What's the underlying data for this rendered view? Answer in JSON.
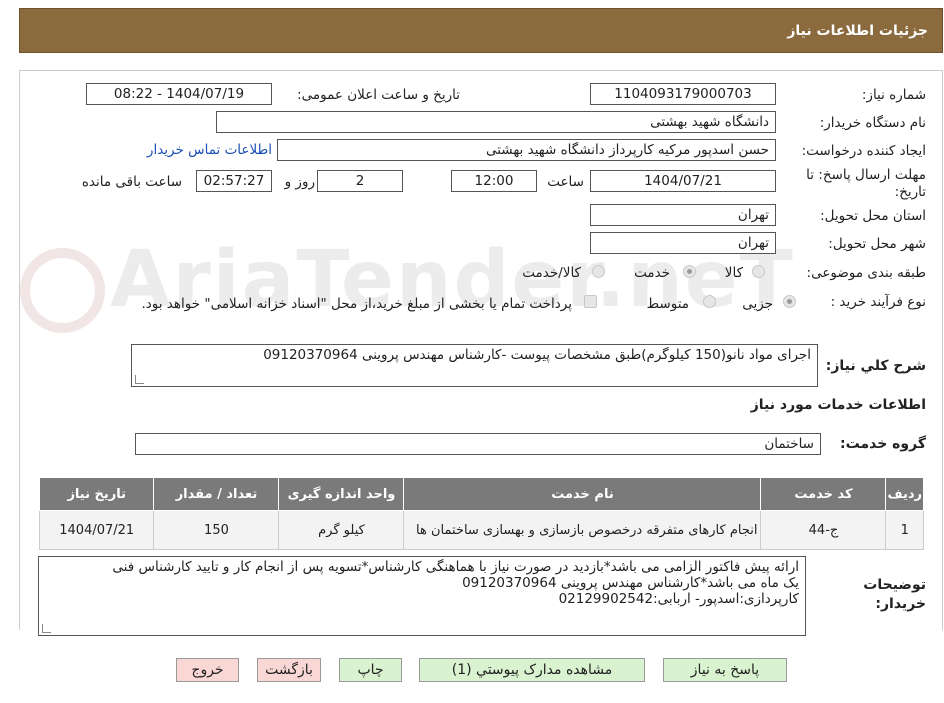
{
  "header": {
    "title": "جزئیات اطلاعات نیاز"
  },
  "form": {
    "need_number_label": "شماره نیاز:",
    "need_number": "1104093179000703",
    "announce_label": "تاریخ و ساعت اعلان عمومی:",
    "announce_value": "1404/07/19 - 08:22",
    "buyer_label": "نام دستگاه خریدار:",
    "buyer_value": "دانشگاه شهید بهشتی",
    "requester_label": "ایجاد کننده درخواست:",
    "requester_value": "حسن اسدپور مرکیه کارپرداز دانشگاه شهید بهشتی",
    "contact_link": "اطلاعات تماس خریدار",
    "deadline_label_1": "مهلت ارسال پاسخ: تا",
    "deadline_label_2": "تاریخ:",
    "deadline_date": "1404/07/21",
    "time_label": "ساعت",
    "deadline_time": "12:00",
    "days_value": "2",
    "days_label": "روز و",
    "remaining_value": "02:57:27",
    "remaining_label": "ساعت باقی مانده",
    "province_label": "استان محل تحویل:",
    "province_value": "تهران",
    "city_label": "شهر محل تحویل:",
    "city_value": "تهران",
    "category_label": "طبقه بندی موضوعی:",
    "category_options": [
      "کالا",
      "خدمت",
      "کالا/خدمت"
    ],
    "category_selected": "خدمت",
    "process_label": "نوع فرآیند خرید :",
    "process_options": [
      "جزیی",
      "متوسط"
    ],
    "process_selected": "جزیی",
    "payment_note": "پرداخت تمام یا بخشی از مبلغ خرید،از محل \"اسناد خزانه اسلامی\" خواهد بود.",
    "description_label": "شرح کلي نیاز:",
    "description_value": "اجرای مواد نانو(150 کیلوگرم)طبق مشخصات پیوست -کارشناس مهندس پروینی 09120370964",
    "services_heading": "اطلاعات خدمات مورد نیاز",
    "service_group_label": "گروه خدمت:",
    "service_group_value": "ساختمان"
  },
  "table": {
    "headers": [
      "ردیف",
      "کد خدمت",
      "نام خدمت",
      "واحد اندازه گیری",
      "تعداد / مقدار",
      "تاریخ نیاز"
    ],
    "rows": [
      [
        "1",
        "ج-44",
        "انجام کارهای متفرقه درخصوص بازسازی و بهسازی ساختمان ها",
        "کیلو گرم",
        "150",
        "1404/07/21"
      ]
    ]
  },
  "buyer_notes": {
    "label_1": "توضیحات",
    "label_2": "خریدار:",
    "line1": "ارائه پیش فاکتور الزامی می باشد*بازدید در صورت نیاز با هماهنگی کارشناس*تسویه پس از انجام کار و تایید کارشناس فنی",
    "line2": "یک ماه می باشد*کارشناس مهندس پروینی 09120370964",
    "line3": "کارپردازی:اسدپور- اربابی:02129902542"
  },
  "buttons": {
    "reply": "پاسخ به نیاز",
    "attachments": "مشاهده مدارک پیوستي (1)",
    "print": "چاپ",
    "back": "بازگشت",
    "exit": "خروج"
  },
  "watermark": "AriaTender.neT",
  "colors": {
    "header_bg": "#8b6a3e",
    "table_header": "#7a7a7a",
    "button_green": "#d9f2d0",
    "button_pink": "#f9d7d5",
    "link": "#1a4fb5"
  }
}
